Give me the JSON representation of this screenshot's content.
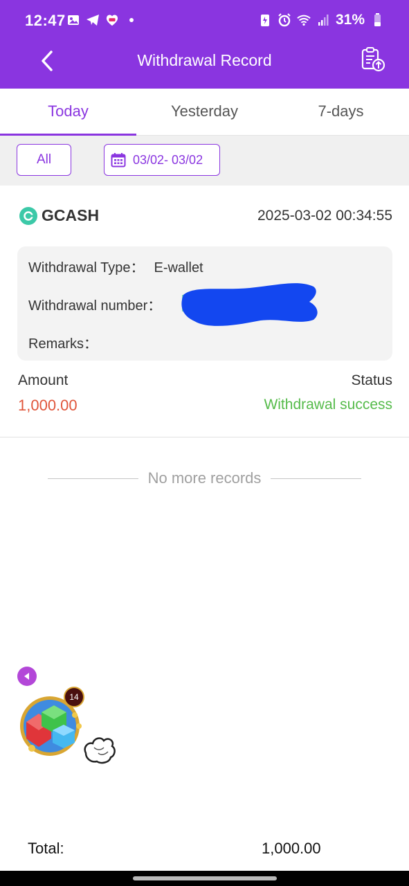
{
  "status_bar": {
    "time": "12:47",
    "battery": "31%",
    "left_icons": [
      "image-icon",
      "telegram-icon",
      "lazada-icon",
      "dot-icon"
    ],
    "right_icons": [
      "battery-saver-icon",
      "alarm-icon",
      "wifi-icon",
      "signal-icon",
      "battery-icon"
    ]
  },
  "header": {
    "title": "Withdrawal Record",
    "back_icon": "chevron-left-icon",
    "action_icon": "clipboard-upload-icon"
  },
  "tabs": [
    {
      "label": "Today",
      "active": true
    },
    {
      "label": "Yesterday",
      "active": false
    },
    {
      "label": "7-days",
      "active": false
    }
  ],
  "filters": {
    "type_label": "All",
    "date_range": "03/02- 03/02",
    "date_icon": "calendar-icon"
  },
  "record": {
    "provider": "GCASH",
    "datetime": "2025-03-02 00:34:55",
    "type_label": "Withdrawal Type：",
    "type_value": "E-wallet",
    "number_label": "Withdrawal number：",
    "remarks_label": "Remarks：",
    "amount_label": "Amount",
    "amount_value": "1,000.00",
    "status_label": "Status",
    "status_value": "Withdrawal success"
  },
  "list_end": "No more records",
  "floating": {
    "badge": "14"
  },
  "footer": {
    "total_label": "Total:",
    "total_value": "1,000.00"
  },
  "colors": {
    "accent": "#8a35e0",
    "amount": "#e0553a",
    "success": "#55bb4a"
  }
}
